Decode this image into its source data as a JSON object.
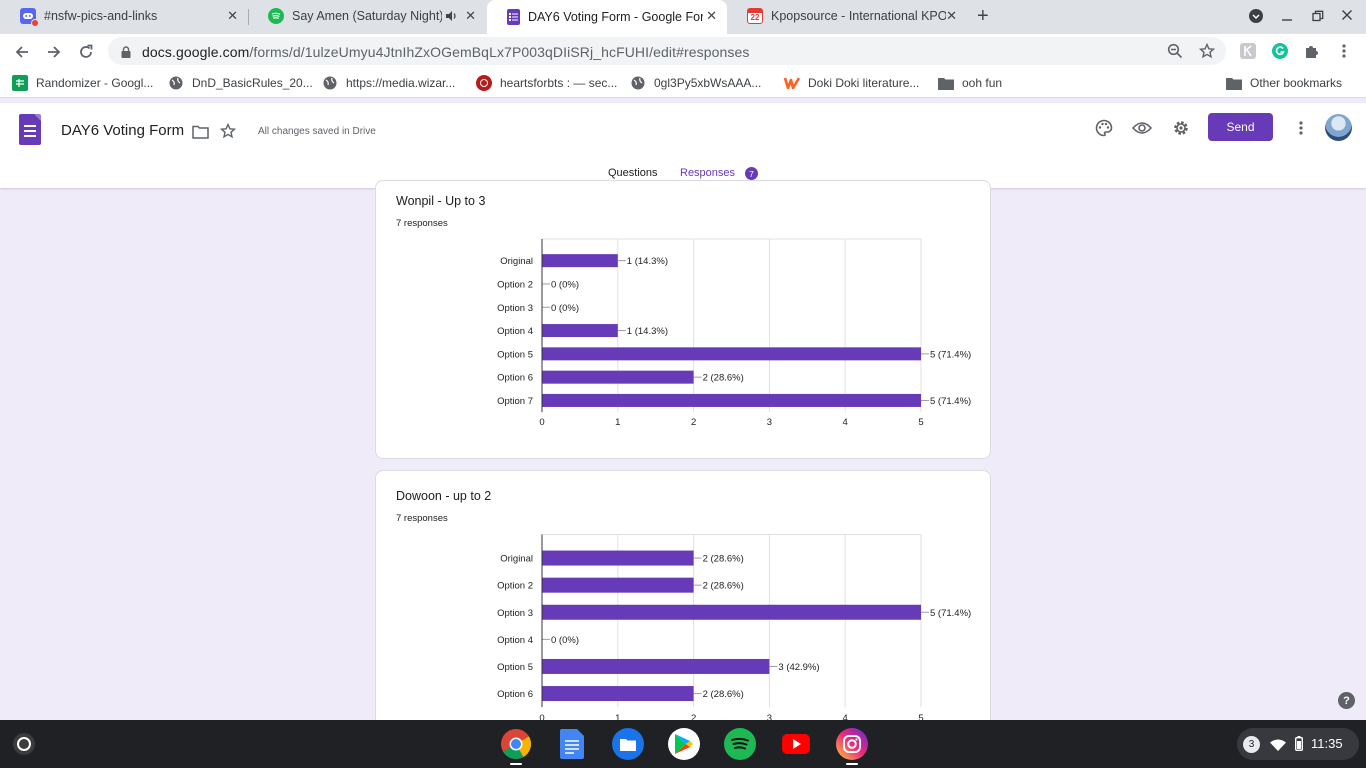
{
  "browser": {
    "tabs": [
      {
        "title": "#nsfw-pics-and-links",
        "icon": "discord-icon"
      },
      {
        "title": "Say Amen (Saturday Night)",
        "icon": "spotify-icon",
        "audio": true
      },
      {
        "title": "DAY6 Voting Form - Google Forms",
        "icon": "google-forms-icon",
        "active": true
      },
      {
        "title": "Kpopsource - International KPOP",
        "icon": "calendar-icon",
        "icon_text": "22"
      }
    ],
    "address": {
      "host": "docs.google.com",
      "path": "/forms/d/1ulzeUmyu4JtnIhZxOGemBqLx7P003qDIiSRj_hcFUHI/edit#responses"
    },
    "bookmarks": [
      {
        "label": "Randomizer - Googl...",
        "icon": "google-sheets-icon"
      },
      {
        "label": "DnD_BasicRules_20...",
        "icon": "globe-icon"
      },
      {
        "label": "https://media.wizar...",
        "icon": "globe-icon"
      },
      {
        "label": "heartsforbts : — sec...",
        "icon": "site-icon"
      },
      {
        "label": "0gl3Py5xbWsAAA...",
        "icon": "globe-icon"
      },
      {
        "label": "Doki Doki literature...",
        "icon": "wattpad-icon"
      },
      {
        "label": "ooh fun",
        "icon": "folder-icon"
      }
    ],
    "other_bookmarks": "Other bookmarks"
  },
  "form": {
    "title": "DAY6 Voting Form",
    "save_status": "All changes saved in Drive",
    "send_label": "Send",
    "tabs": {
      "questions": "Questions",
      "responses": "Responses",
      "responses_count": "7"
    },
    "accent_color": "#673ab7"
  },
  "questions": [
    {
      "title": "Wonpil - Up to 3",
      "responses": "7 responses",
      "chart_data": {
        "type": "bar",
        "orientation": "horizontal",
        "categories": [
          "Original",
          "Option 2",
          "Option 3",
          "Option 4",
          "Option 5",
          "Option 6",
          "Option 7"
        ],
        "values": [
          1,
          0,
          0,
          1,
          5,
          2,
          5
        ],
        "data_labels": [
          "1 (14.3%)",
          "0 (0%)",
          "0 (0%)",
          "1 (14.3%)",
          "5 (71.4%)",
          "2 (28.6%)",
          "5 (71.4%)"
        ],
        "xticks": [
          "0",
          "1",
          "2",
          "3",
          "4",
          "5"
        ],
        "xlim": [
          0,
          5
        ],
        "color": "#673ab7"
      }
    },
    {
      "title": "Dowoon - up to 2",
      "responses": "7 responses",
      "chart_data": {
        "type": "bar",
        "orientation": "horizontal",
        "categories": [
          "Original",
          "Option 2",
          "Option 3",
          "Option 4",
          "Option 5",
          "Option 6"
        ],
        "values": [
          2,
          2,
          5,
          0,
          3,
          2
        ],
        "data_labels": [
          "2 (28.6%)",
          "2 (28.6%)",
          "5 (71.4%)",
          "0 (0%)",
          "3 (42.9%)",
          "2 (28.6%)"
        ],
        "xticks": [
          "0",
          "1",
          "2",
          "3",
          "4",
          "5"
        ],
        "xlim": [
          0,
          5
        ],
        "color": "#673ab7"
      }
    }
  ],
  "help_label": "?",
  "shelf": {
    "apps": [
      {
        "name": "chrome",
        "icon": "chrome-icon",
        "running": true
      },
      {
        "name": "docs",
        "icon": "google-docs-icon"
      },
      {
        "name": "files",
        "icon": "files-icon"
      },
      {
        "name": "play",
        "icon": "play-store-icon"
      },
      {
        "name": "spotify",
        "icon": "spotify-icon"
      },
      {
        "name": "youtube",
        "icon": "youtube-icon"
      },
      {
        "name": "instagram",
        "icon": "instagram-icon",
        "running": true
      }
    ],
    "notification_count": "3",
    "time": "11:35"
  }
}
